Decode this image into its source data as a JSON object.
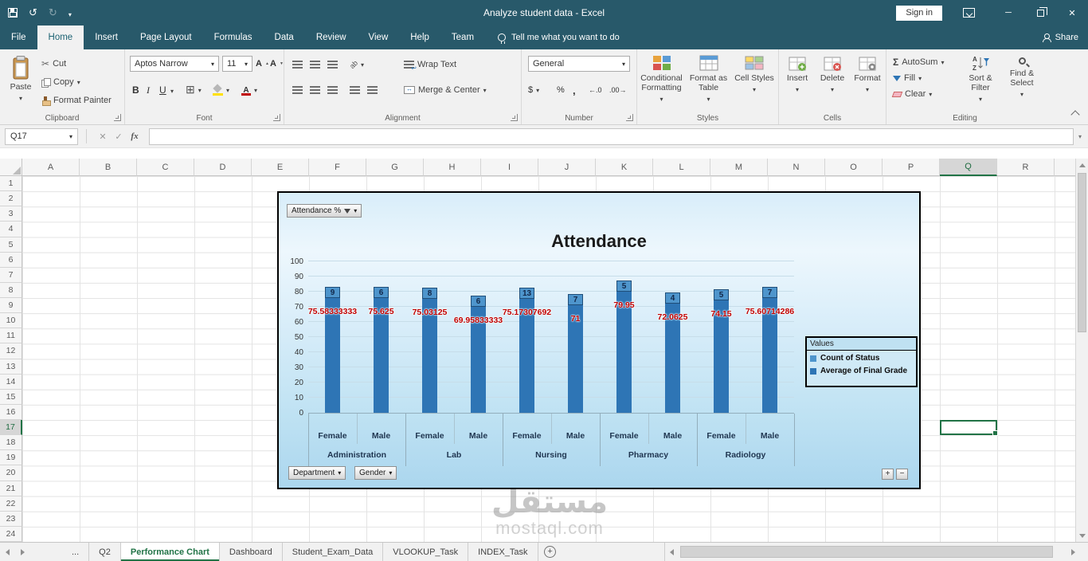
{
  "titlebar": {
    "title": "Analyze student data - Excel",
    "sign_in": "Sign in"
  },
  "tabs": {
    "items": [
      "File",
      "Home",
      "Insert",
      "Page Layout",
      "Formulas",
      "Data",
      "Review",
      "View",
      "Help",
      "Team"
    ],
    "active": "Home",
    "tell_me": "Tell me what you want to do",
    "share": "Share"
  },
  "ribbon": {
    "clipboard": {
      "label": "Clipboard",
      "paste": "Paste",
      "cut": "Cut",
      "copy": "Copy",
      "format_painter": "Format Painter"
    },
    "font": {
      "label": "Font",
      "name": "Aptos Narrow",
      "size": "11"
    },
    "alignment": {
      "label": "Alignment",
      "wrap": "Wrap Text",
      "merge": "Merge & Center"
    },
    "number": {
      "label": "Number",
      "format": "General"
    },
    "styles": {
      "label": "Styles",
      "items": [
        "Conditional Formatting",
        "Format as Table",
        "Cell Styles"
      ]
    },
    "cells": {
      "label": "Cells",
      "items": [
        "Insert",
        "Delete",
        "Format"
      ]
    },
    "editing": {
      "label": "Editing",
      "autosum": "AutoSum",
      "fill": "Fill",
      "clear": "Clear",
      "sort": "Sort & Filter",
      "find": "Find & Select"
    }
  },
  "formula_bar": {
    "name_box": "Q17",
    "fx": "fx",
    "value": ""
  },
  "grid": {
    "column_letters": [
      "A",
      "B",
      "C",
      "D",
      "E",
      "F",
      "G",
      "H",
      "I",
      "J",
      "K",
      "L",
      "M",
      "N",
      "O",
      "P",
      "Q",
      "R"
    ],
    "row_count": 24,
    "selected": {
      "column": "Q",
      "row": 17,
      "cell": "Q17"
    }
  },
  "chart_ui": {
    "field_button": "Attendance %",
    "axis_buttons": [
      "Department",
      "Gender"
    ],
    "legend_title": "Values",
    "expand": "+",
    "collapse": "−"
  },
  "chart_data": {
    "type": "bar",
    "title": "Attendance",
    "categories": [
      "Female",
      "Male",
      "Female",
      "Male",
      "Female",
      "Male",
      "Female",
      "Male",
      "Female",
      "Male"
    ],
    "group_labels": [
      "Administration",
      "Lab",
      "Nursing",
      "Pharmacy",
      "Radiology"
    ],
    "series": [
      {
        "name": "Count of Status",
        "color": "#4e95cc",
        "values": [
          9,
          6,
          8,
          6,
          13,
          7,
          5,
          4,
          5,
          7
        ]
      },
      {
        "name": "Average of Final Grade",
        "color": "#2e75b5",
        "values": [
          75.58333333,
          75.625,
          75.03125,
          69.95833333,
          75.17307692,
          71,
          79.95,
          72.0625,
          74.15,
          75.60714286
        ]
      }
    ],
    "value_labels": [
      "75.58333333",
      "75.625",
      "75.03125",
      "69.95833333",
      "75.17307692",
      "71",
      "79.95",
      "72.0625",
      "74.15",
      "75.60714286"
    ],
    "value_label_color": "#c00000",
    "ylim": [
      0,
      100
    ],
    "ytick_step": 10,
    "grid": true,
    "legend_position": "right"
  },
  "watermark": {
    "line1": "مستقل",
    "line2": "mostaql.com"
  },
  "sheet_tabs": {
    "nav_ellipsis": "...",
    "items": [
      "Q2",
      "Performance Chart",
      "Dashboard",
      "Student_Exam_Data",
      "VLOOKUP_Task",
      "INDEX_Task"
    ],
    "active": "Performance Chart"
  },
  "icons": {
    "save-icon": "floppy",
    "undo-icon": "↺",
    "redo-icon": "↻",
    "qat-dropdown-icon": "▾",
    "ribbon-display-options-icon": "box-chevron",
    "minimize-icon": "─",
    "restore-icon": "❐",
    "close-icon": "✕",
    "lightbulb-icon": "bulb",
    "share-person-icon": "person",
    "paste-icon": "clipboard",
    "cut-icon": "✂",
    "copy-icon": "double-sheet",
    "format-painter-icon": "brush",
    "bold-icon": "B",
    "italic-icon": "I",
    "underline-icon": "U",
    "borders-icon": "⊞",
    "fill-color-icon": "bucket-yellow",
    "font-color-icon": "A-red",
    "align-icon": "lines",
    "orientation-icon": "ab-diagonal",
    "wrap-text-icon": "lines-return",
    "merge-center-icon": "box-arrows",
    "currency-icon": "$",
    "percent-icon": "%",
    "comma-icon": ",",
    "increase-decimal-icon": "←.0",
    "decrease-decimal-icon": ".00→",
    "autosum-icon": "Σ",
    "fill-down-icon": "▼",
    "clear-icon": "eraser",
    "sort-filter-icon": "AZ-funnel",
    "find-select-icon": "magnifier",
    "dialog-launcher-icon": "↘",
    "collapse-ribbon-icon": "⌃",
    "cancel-icon": "✕",
    "enter-icon": "✓",
    "formula-expand-icon": "▾",
    "filter-funnel-icon": "▼",
    "dropdown-icon": "▾",
    "sheet-nav-left-icon": "◀",
    "sheet-nav-right-icon": "▶",
    "new-sheet-icon": "⊕",
    "scroll-up-icon": "▲",
    "scroll-down-icon": "▼",
    "scroll-left-icon": "◀",
    "scroll-right-icon": "▶"
  }
}
